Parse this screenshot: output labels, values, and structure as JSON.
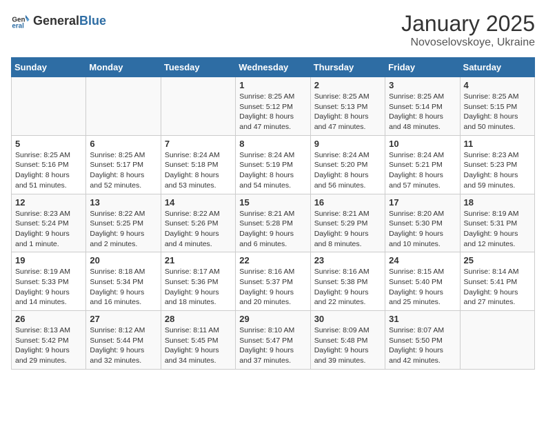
{
  "header": {
    "logo_general": "General",
    "logo_blue": "Blue",
    "main_title": "January 2025",
    "sub_title": "Novoselovskoye, Ukraine"
  },
  "weekdays": [
    "Sunday",
    "Monday",
    "Tuesday",
    "Wednesday",
    "Thursday",
    "Friday",
    "Saturday"
  ],
  "weeks": [
    [
      {
        "day": "",
        "info": ""
      },
      {
        "day": "",
        "info": ""
      },
      {
        "day": "",
        "info": ""
      },
      {
        "day": "1",
        "info": "Sunrise: 8:25 AM\nSunset: 5:12 PM\nDaylight: 8 hours and 47 minutes."
      },
      {
        "day": "2",
        "info": "Sunrise: 8:25 AM\nSunset: 5:13 PM\nDaylight: 8 hours and 47 minutes."
      },
      {
        "day": "3",
        "info": "Sunrise: 8:25 AM\nSunset: 5:14 PM\nDaylight: 8 hours and 48 minutes."
      },
      {
        "day": "4",
        "info": "Sunrise: 8:25 AM\nSunset: 5:15 PM\nDaylight: 8 hours and 50 minutes."
      }
    ],
    [
      {
        "day": "5",
        "info": "Sunrise: 8:25 AM\nSunset: 5:16 PM\nDaylight: 8 hours and 51 minutes."
      },
      {
        "day": "6",
        "info": "Sunrise: 8:25 AM\nSunset: 5:17 PM\nDaylight: 8 hours and 52 minutes."
      },
      {
        "day": "7",
        "info": "Sunrise: 8:24 AM\nSunset: 5:18 PM\nDaylight: 8 hours and 53 minutes."
      },
      {
        "day": "8",
        "info": "Sunrise: 8:24 AM\nSunset: 5:19 PM\nDaylight: 8 hours and 54 minutes."
      },
      {
        "day": "9",
        "info": "Sunrise: 8:24 AM\nSunset: 5:20 PM\nDaylight: 8 hours and 56 minutes."
      },
      {
        "day": "10",
        "info": "Sunrise: 8:24 AM\nSunset: 5:21 PM\nDaylight: 8 hours and 57 minutes."
      },
      {
        "day": "11",
        "info": "Sunrise: 8:23 AM\nSunset: 5:23 PM\nDaylight: 8 hours and 59 minutes."
      }
    ],
    [
      {
        "day": "12",
        "info": "Sunrise: 8:23 AM\nSunset: 5:24 PM\nDaylight: 9 hours and 1 minute."
      },
      {
        "day": "13",
        "info": "Sunrise: 8:22 AM\nSunset: 5:25 PM\nDaylight: 9 hours and 2 minutes."
      },
      {
        "day": "14",
        "info": "Sunrise: 8:22 AM\nSunset: 5:26 PM\nDaylight: 9 hours and 4 minutes."
      },
      {
        "day": "15",
        "info": "Sunrise: 8:21 AM\nSunset: 5:28 PM\nDaylight: 9 hours and 6 minutes."
      },
      {
        "day": "16",
        "info": "Sunrise: 8:21 AM\nSunset: 5:29 PM\nDaylight: 9 hours and 8 minutes."
      },
      {
        "day": "17",
        "info": "Sunrise: 8:20 AM\nSunset: 5:30 PM\nDaylight: 9 hours and 10 minutes."
      },
      {
        "day": "18",
        "info": "Sunrise: 8:19 AM\nSunset: 5:31 PM\nDaylight: 9 hours and 12 minutes."
      }
    ],
    [
      {
        "day": "19",
        "info": "Sunrise: 8:19 AM\nSunset: 5:33 PM\nDaylight: 9 hours and 14 minutes."
      },
      {
        "day": "20",
        "info": "Sunrise: 8:18 AM\nSunset: 5:34 PM\nDaylight: 9 hours and 16 minutes."
      },
      {
        "day": "21",
        "info": "Sunrise: 8:17 AM\nSunset: 5:36 PM\nDaylight: 9 hours and 18 minutes."
      },
      {
        "day": "22",
        "info": "Sunrise: 8:16 AM\nSunset: 5:37 PM\nDaylight: 9 hours and 20 minutes."
      },
      {
        "day": "23",
        "info": "Sunrise: 8:16 AM\nSunset: 5:38 PM\nDaylight: 9 hours and 22 minutes."
      },
      {
        "day": "24",
        "info": "Sunrise: 8:15 AM\nSunset: 5:40 PM\nDaylight: 9 hours and 25 minutes."
      },
      {
        "day": "25",
        "info": "Sunrise: 8:14 AM\nSunset: 5:41 PM\nDaylight: 9 hours and 27 minutes."
      }
    ],
    [
      {
        "day": "26",
        "info": "Sunrise: 8:13 AM\nSunset: 5:42 PM\nDaylight: 9 hours and 29 minutes."
      },
      {
        "day": "27",
        "info": "Sunrise: 8:12 AM\nSunset: 5:44 PM\nDaylight: 9 hours and 32 minutes."
      },
      {
        "day": "28",
        "info": "Sunrise: 8:11 AM\nSunset: 5:45 PM\nDaylight: 9 hours and 34 minutes."
      },
      {
        "day": "29",
        "info": "Sunrise: 8:10 AM\nSunset: 5:47 PM\nDaylight: 9 hours and 37 minutes."
      },
      {
        "day": "30",
        "info": "Sunrise: 8:09 AM\nSunset: 5:48 PM\nDaylight: 9 hours and 39 minutes."
      },
      {
        "day": "31",
        "info": "Sunrise: 8:07 AM\nSunset: 5:50 PM\nDaylight: 9 hours and 42 minutes."
      },
      {
        "day": "",
        "info": ""
      }
    ]
  ]
}
